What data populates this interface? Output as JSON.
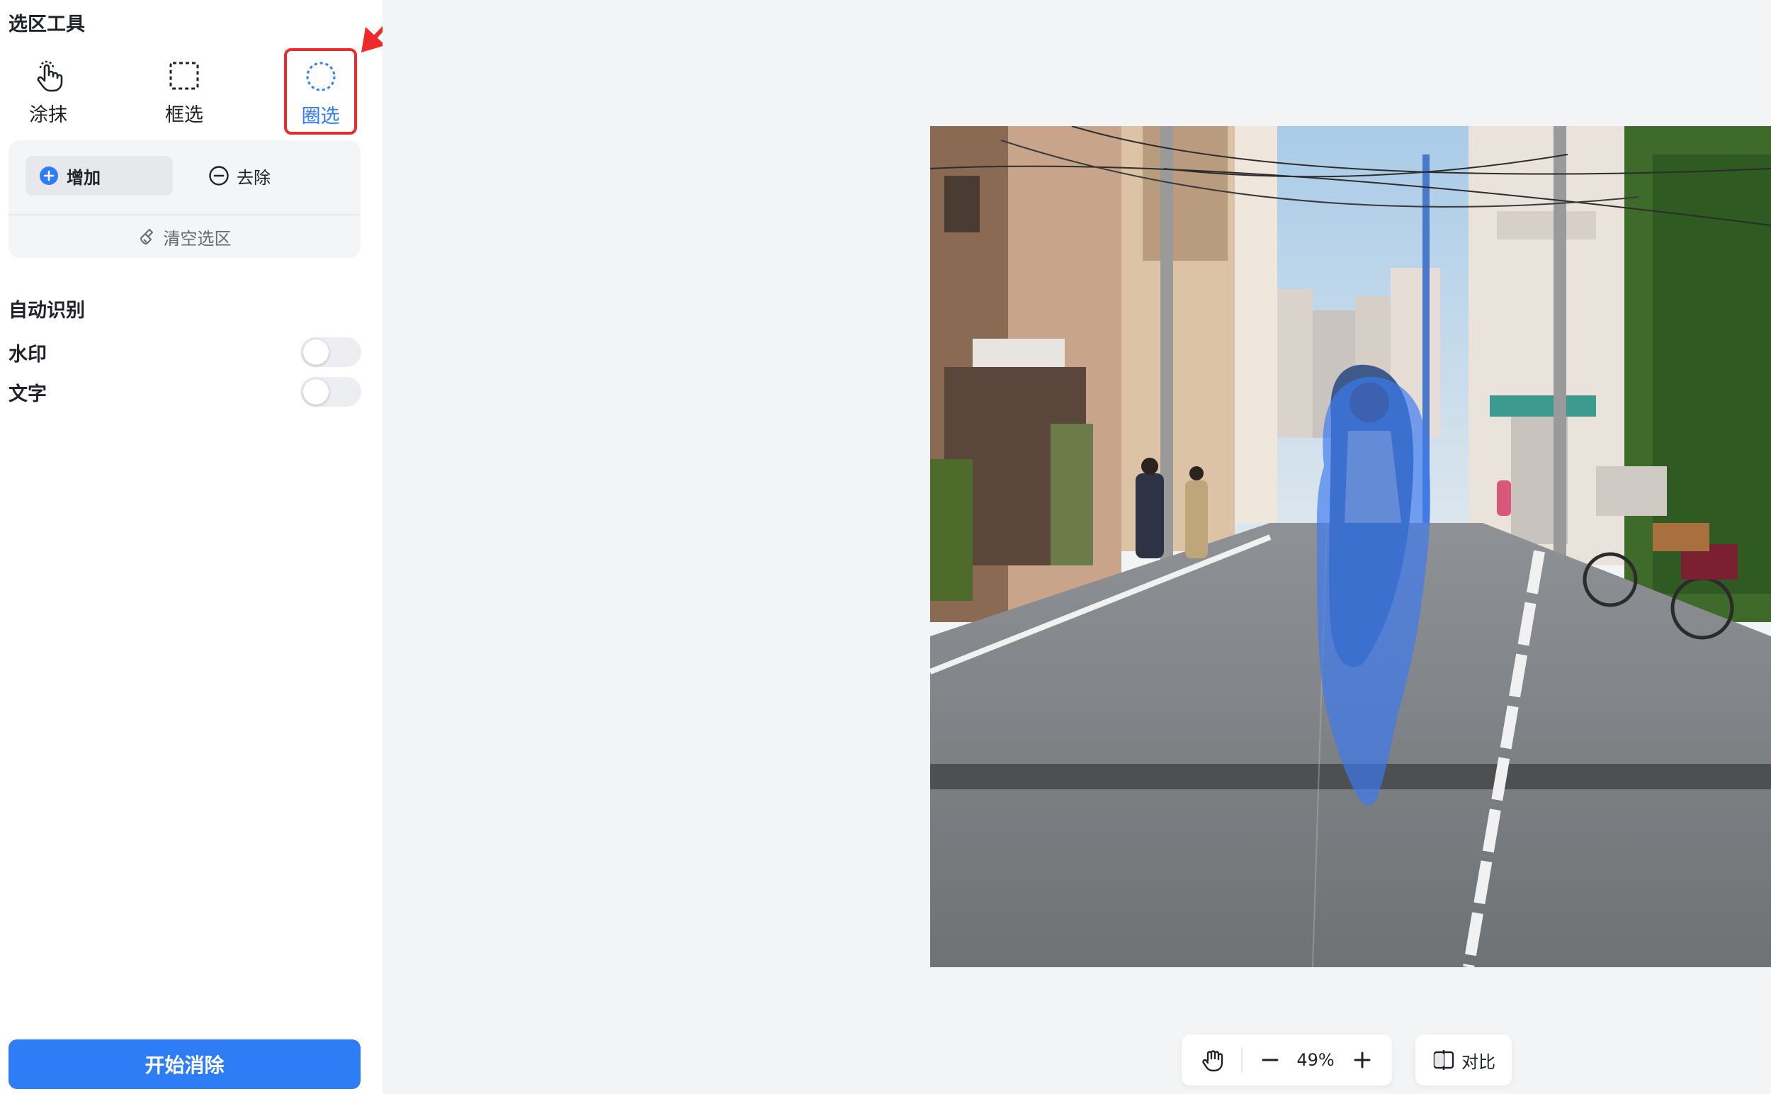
{
  "sidebar": {
    "tools_title": "选区工具",
    "tools": [
      {
        "id": "smear",
        "label": "涂抹",
        "icon": "finger-tap-icon",
        "active": false
      },
      {
        "id": "box",
        "label": "框选",
        "icon": "dashed-rectangle-icon",
        "active": false
      },
      {
        "id": "lasso",
        "label": "圈选",
        "icon": "dashed-circle-icon",
        "active": true
      }
    ],
    "mode": {
      "add_label": "增加",
      "remove_label": "去除",
      "clear_label": "清空选区"
    },
    "auto_detect": {
      "title": "自动识别",
      "watermark_label": "水印",
      "watermark_on": false,
      "text_label": "文字",
      "text_on": false
    },
    "start_label": "开始消除"
  },
  "toolbar": {
    "zoom_text": "49%",
    "compare_label": "对比"
  },
  "colors": {
    "accent": "#2e7cf6",
    "highlight_border": "#ef2a2a",
    "selection_overlay": "#3d7bf0"
  }
}
